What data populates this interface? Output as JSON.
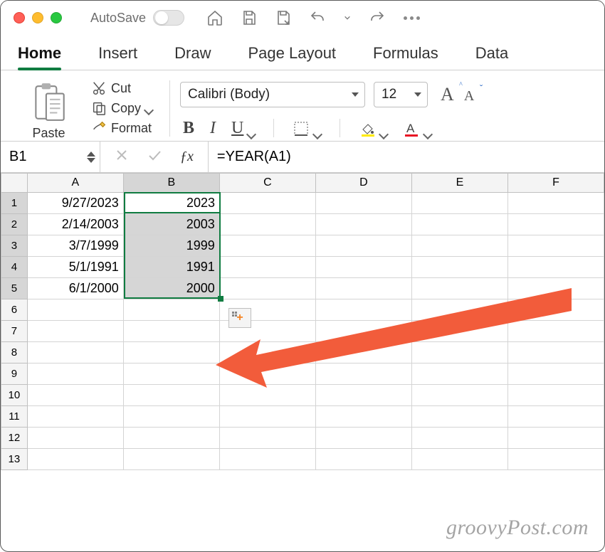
{
  "titlebar": {
    "autosave_label": "AutoSave"
  },
  "tabs": [
    "Home",
    "Insert",
    "Draw",
    "Page Layout",
    "Formulas",
    "Data"
  ],
  "active_tab": "Home",
  "ribbon": {
    "paste_label": "Paste",
    "cut_label": "Cut",
    "copy_label": "Copy",
    "format_label": "Format",
    "font_name": "Calibri (Body)",
    "font_size": "12"
  },
  "name_box": "B1",
  "formula": "=YEAR(A1)",
  "columns": [
    "A",
    "B",
    "C",
    "D",
    "E",
    "F"
  ],
  "rows": [
    {
      "n": "1",
      "A": "9/27/2023",
      "B": "2023"
    },
    {
      "n": "2",
      "A": "2/14/2003",
      "B": "2003"
    },
    {
      "n": "3",
      "A": "3/7/1999",
      "B": "1999"
    },
    {
      "n": "4",
      "A": "5/1/1991",
      "B": "1991"
    },
    {
      "n": "5",
      "A": "6/1/2000",
      "B": "2000"
    },
    {
      "n": "6"
    },
    {
      "n": "7"
    },
    {
      "n": "8"
    },
    {
      "n": "9"
    },
    {
      "n": "10"
    },
    {
      "n": "11"
    },
    {
      "n": "12"
    },
    {
      "n": "13"
    }
  ],
  "selection": {
    "col": "B",
    "row_start": 1,
    "row_end": 5,
    "active_cell": "B1"
  },
  "watermark": "groovyPost.com"
}
